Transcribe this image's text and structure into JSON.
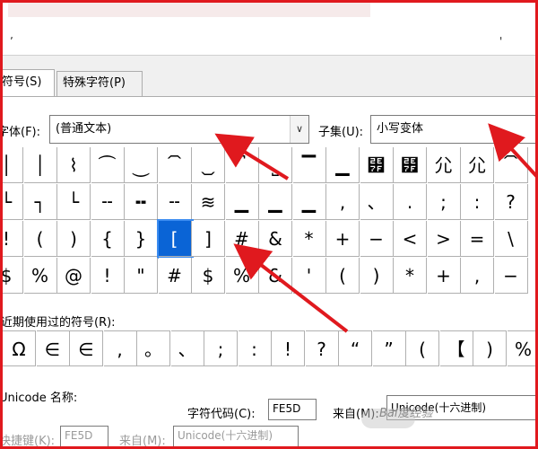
{
  "dialog": {
    "title_mark_left": "ʼ",
    "title_mark_right": "'"
  },
  "tabs": [
    {
      "label": "符号(S)"
    },
    {
      "label": "特殊字符(P)"
    }
  ],
  "font": {
    "label": "字体(F):",
    "value": "(普通文本)",
    "dropdown_glyph": "∨"
  },
  "subset": {
    "label": "子集(U):",
    "value": "小写变体"
  },
  "symbol_grid": {
    "rows": [
      [
        "│",
        "│",
        "⌇",
        "⏜",
        "⏝",
        "⏠",
        "⏡",
        "⎴",
        "⎵",
        "▔",
        "▁",
        "⹿",
        "⹿",
        "⺏",
        "⺏",
        "⏠"
      ],
      [
        "└",
        "┐",
        "└",
        "╌",
        "╍",
        "╌",
        "≋",
        "▁",
        "▁",
        "▁",
        ",",
        "、",
        ".",
        ";",
        ":",
        "?"
      ],
      [
        "!",
        "(",
        ")",
        "{",
        "}",
        "[",
        "]",
        "#",
        "&",
        "*",
        "+",
        "−",
        "<",
        ">",
        "=",
        "\\"
      ],
      [
        "$",
        "%",
        "@",
        "!",
        "\"",
        "#",
        "$",
        "%",
        "&",
        "'",
        "(",
        ")",
        "*",
        "+",
        ",",
        "−"
      ]
    ],
    "selected": {
      "row": 2,
      "col": 5
    }
  },
  "recent": {
    "label": "近期使用过的符号(R):",
    "symbols": [
      "Ω",
      "∈",
      "∈",
      ",",
      "。",
      "、",
      ";",
      ":",
      "!",
      "?",
      "“",
      "”",
      "(",
      "【",
      ")",
      "%"
    ]
  },
  "unicode": {
    "name_label": "Unicode 名称:",
    "char_code_label": "字符代码(C):",
    "char_code_value": "FE5D",
    "from_label": "来自(M):",
    "from_value": "Unicode(十六进制)",
    "shortcut_label": "快捷键(K):",
    "shortcut_value": "FE5D",
    "from2_label": "来自(M):",
    "from2_value": "Unicode(十六进制)"
  },
  "watermark": {
    "text": "Bai度经验"
  },
  "colors": {
    "annotation_red": "#e0191e",
    "selection_blue": "#0a64d6"
  }
}
